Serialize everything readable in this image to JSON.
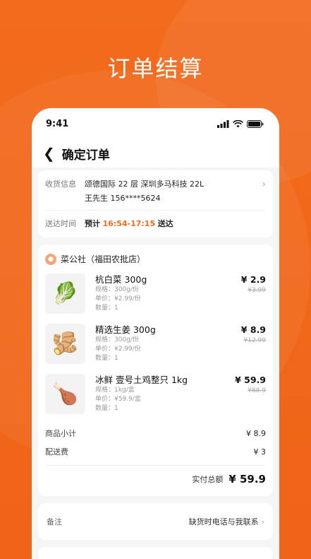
{
  "hero_title": "订单结算",
  "status_bar": {
    "time": "9:41"
  },
  "header": {
    "title": "确定订单"
  },
  "address": {
    "label": "收货信息",
    "line1": "颂德国际 22 层 深圳多马科技 22L",
    "line2": "王先生  156****5624",
    "time_label": "送达时间",
    "time_prefix": "预计",
    "time_range": "16:54-17:15",
    "time_suffix": "送达"
  },
  "store": {
    "name": "菜公社（福田农批店）",
    "items": [
      {
        "name": "杭白菜 300g",
        "spec": "规格：300g/份",
        "unit_price": "单价：¥2.99/份",
        "qty": "数量：1",
        "price": "¥ 2.9",
        "old_price": "¥3.99",
        "icon": "cabbage-icon",
        "glyph": "🥬"
      },
      {
        "name": "精选生姜 300g",
        "spec": "规格：300g/份",
        "unit_price": "单价：¥2.99/份",
        "qty": "数量：1",
        "price": "¥ 8.9",
        "old_price": "¥12.99",
        "icon": "ginger-icon",
        "glyph": "🫚"
      },
      {
        "name": "冰鲜 壹号土鸡整只 1kg",
        "spec": "规格：1kg/盒",
        "unit_price": "单价：¥59.9/盒",
        "qty": "数量：1",
        "price": "¥ 59.9",
        "old_price": "¥88.9",
        "icon": "chicken-icon",
        "glyph": "🍗"
      }
    ],
    "subtotal_label": "商品小计",
    "subtotal_value": "¥ 8.9",
    "delivery_label": "配送费",
    "delivery_value": "¥ 3",
    "total_label": "实付总额",
    "total_value": "¥ 59.9"
  },
  "remark": {
    "label": "备注",
    "value": "缺货时电话与我联系"
  },
  "colors": {
    "accent": "#f26a1b"
  }
}
